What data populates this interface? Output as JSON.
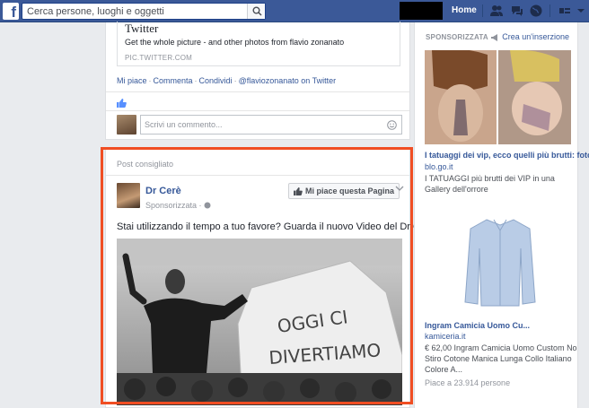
{
  "topbar": {
    "logo_letter": "f",
    "search_placeholder": "Cerca persone, luoghi e oggetti",
    "home_label": "Home"
  },
  "shared_post": {
    "link_title": "Twitter",
    "link_description": "Get the whole picture - and other photos from flavio zonanato",
    "link_url": "PIC.TWITTER.COM",
    "actions": [
      "Mi piace",
      "Commenta",
      "Condividi",
      "@flaviozonanato on Twitter"
    ],
    "comment_placeholder": "Scrivi un commento..."
  },
  "suggested_post": {
    "header": "Post consigliato",
    "page_name": "Dr Cerè",
    "meta": "Sponsorizzata",
    "like_page_label": "Mi piace questa Pagina",
    "text": "Stai utilizzando il tempo a tuo favore? Guarda il nuovo Video del Dr Cerè!",
    "banner_line1": "OGGI CI",
    "banner_line2": "DIVERTIAMO"
  },
  "sidebar": {
    "sponsored_label": "SPONSORIZZATA",
    "create_ad": "Crea un'inserzione",
    "ads": [
      {
        "title": "I tatuaggi dei vip, ecco quelli più brutti: foto",
        "domain": "blo.go.it",
        "description": "I TATUAGGI più brutti dei VIP in una Gallery dell'orrore"
      },
      {
        "title": "Ingram Camicia Uomo Cu...",
        "domain": "kamiceria.it",
        "description": "€ 62,00 Ingram Camicia Uomo Custom No Stiro Cotone Manica Lunga Collo Italiano Colore A...",
        "likes": "Piace a 23.914 persone"
      }
    ]
  },
  "colors": {
    "topbar": "#3b5998",
    "link": "#365899",
    "highlight_frame": "#f04e23"
  }
}
